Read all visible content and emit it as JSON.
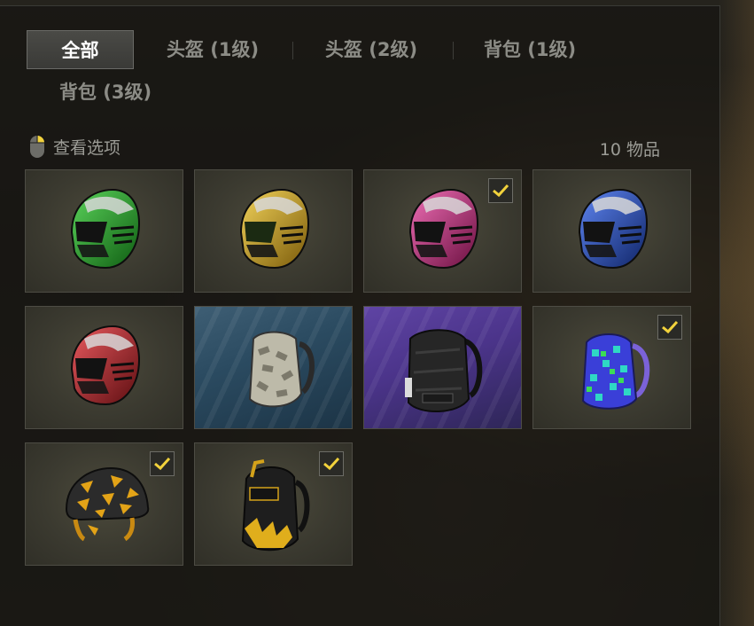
{
  "tabs": [
    {
      "label": "全部",
      "active": true
    },
    {
      "label": "头盔 (1级)",
      "active": false
    },
    {
      "label": "头盔 (2级)",
      "active": false
    },
    {
      "label": "背包 (1级)",
      "active": false
    },
    {
      "label": "背包 (3级)",
      "active": false
    }
  ],
  "toolbar": {
    "view_options_label": "查看选项",
    "item_count": "10 物品",
    "mouse_icon": "mouse-icon"
  },
  "colors": {
    "accent_check": "#f2d23c",
    "tab_active_text": "#ffffff",
    "tab_inactive_text": "#8c8c86"
  },
  "items": [
    {
      "icon": "helmet-icon",
      "color": "#1f8a24",
      "background": "olive",
      "checked": false
    },
    {
      "icon": "helmet-icon",
      "color": "#c79a1a",
      "background": "olive",
      "checked": false
    },
    {
      "icon": "helmet-icon",
      "color": "#c0307e",
      "background": "olive",
      "checked": true
    },
    {
      "icon": "helmet-icon",
      "color": "#1f47c4",
      "background": "olive",
      "checked": false
    },
    {
      "icon": "helmet-icon",
      "color": "#b0242a",
      "background": "olive",
      "checked": false
    },
    {
      "icon": "backpack-icon",
      "color": "#b9b6a6",
      "background": "blue",
      "checked": false
    },
    {
      "icon": "backpack-icon",
      "color": "#2a2a2a",
      "background": "purple",
      "checked": false
    },
    {
      "icon": "backpack-icon",
      "color": "#3a3fd8",
      "background": "olive",
      "checked": true
    },
    {
      "icon": "military-helmet-icon",
      "color": "#e3a317",
      "background": "olive",
      "checked": true
    },
    {
      "icon": "backpack-icon",
      "color": "#1e1e1e",
      "background": "olive",
      "checked": true
    }
  ]
}
